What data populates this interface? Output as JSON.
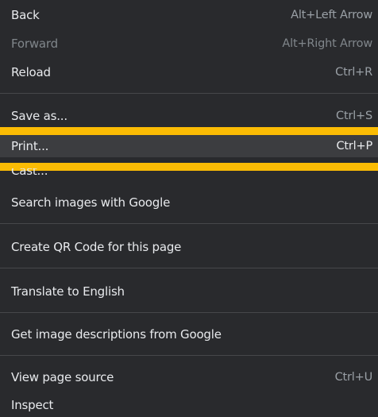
{
  "menu": {
    "items": [
      {
        "label": "Back",
        "shortcut": "Alt+Left Arrow"
      },
      {
        "label": "Forward",
        "shortcut": "Alt+Right Arrow"
      },
      {
        "label": "Reload",
        "shortcut": "Ctrl+R"
      },
      {
        "label": "Save as...",
        "shortcut": "Ctrl+S"
      },
      {
        "label": "Print...",
        "shortcut": "Ctrl+P"
      },
      {
        "label": "Cast..."
      },
      {
        "label": "Search images with Google"
      },
      {
        "label": "Create QR Code for this page"
      },
      {
        "label": "Translate to English"
      },
      {
        "label": "Get image descriptions from Google"
      },
      {
        "label": "View page source",
        "shortcut": "Ctrl+U"
      },
      {
        "label": "Inspect"
      }
    ]
  },
  "colors": {
    "menu_background": "#292a2d",
    "text": "#e8eaed",
    "shortcut_text": "#9aa0a6",
    "disabled_text": "#80868b",
    "highlight": "#3c3d40",
    "annotation_bar": "#fbbc04"
  }
}
